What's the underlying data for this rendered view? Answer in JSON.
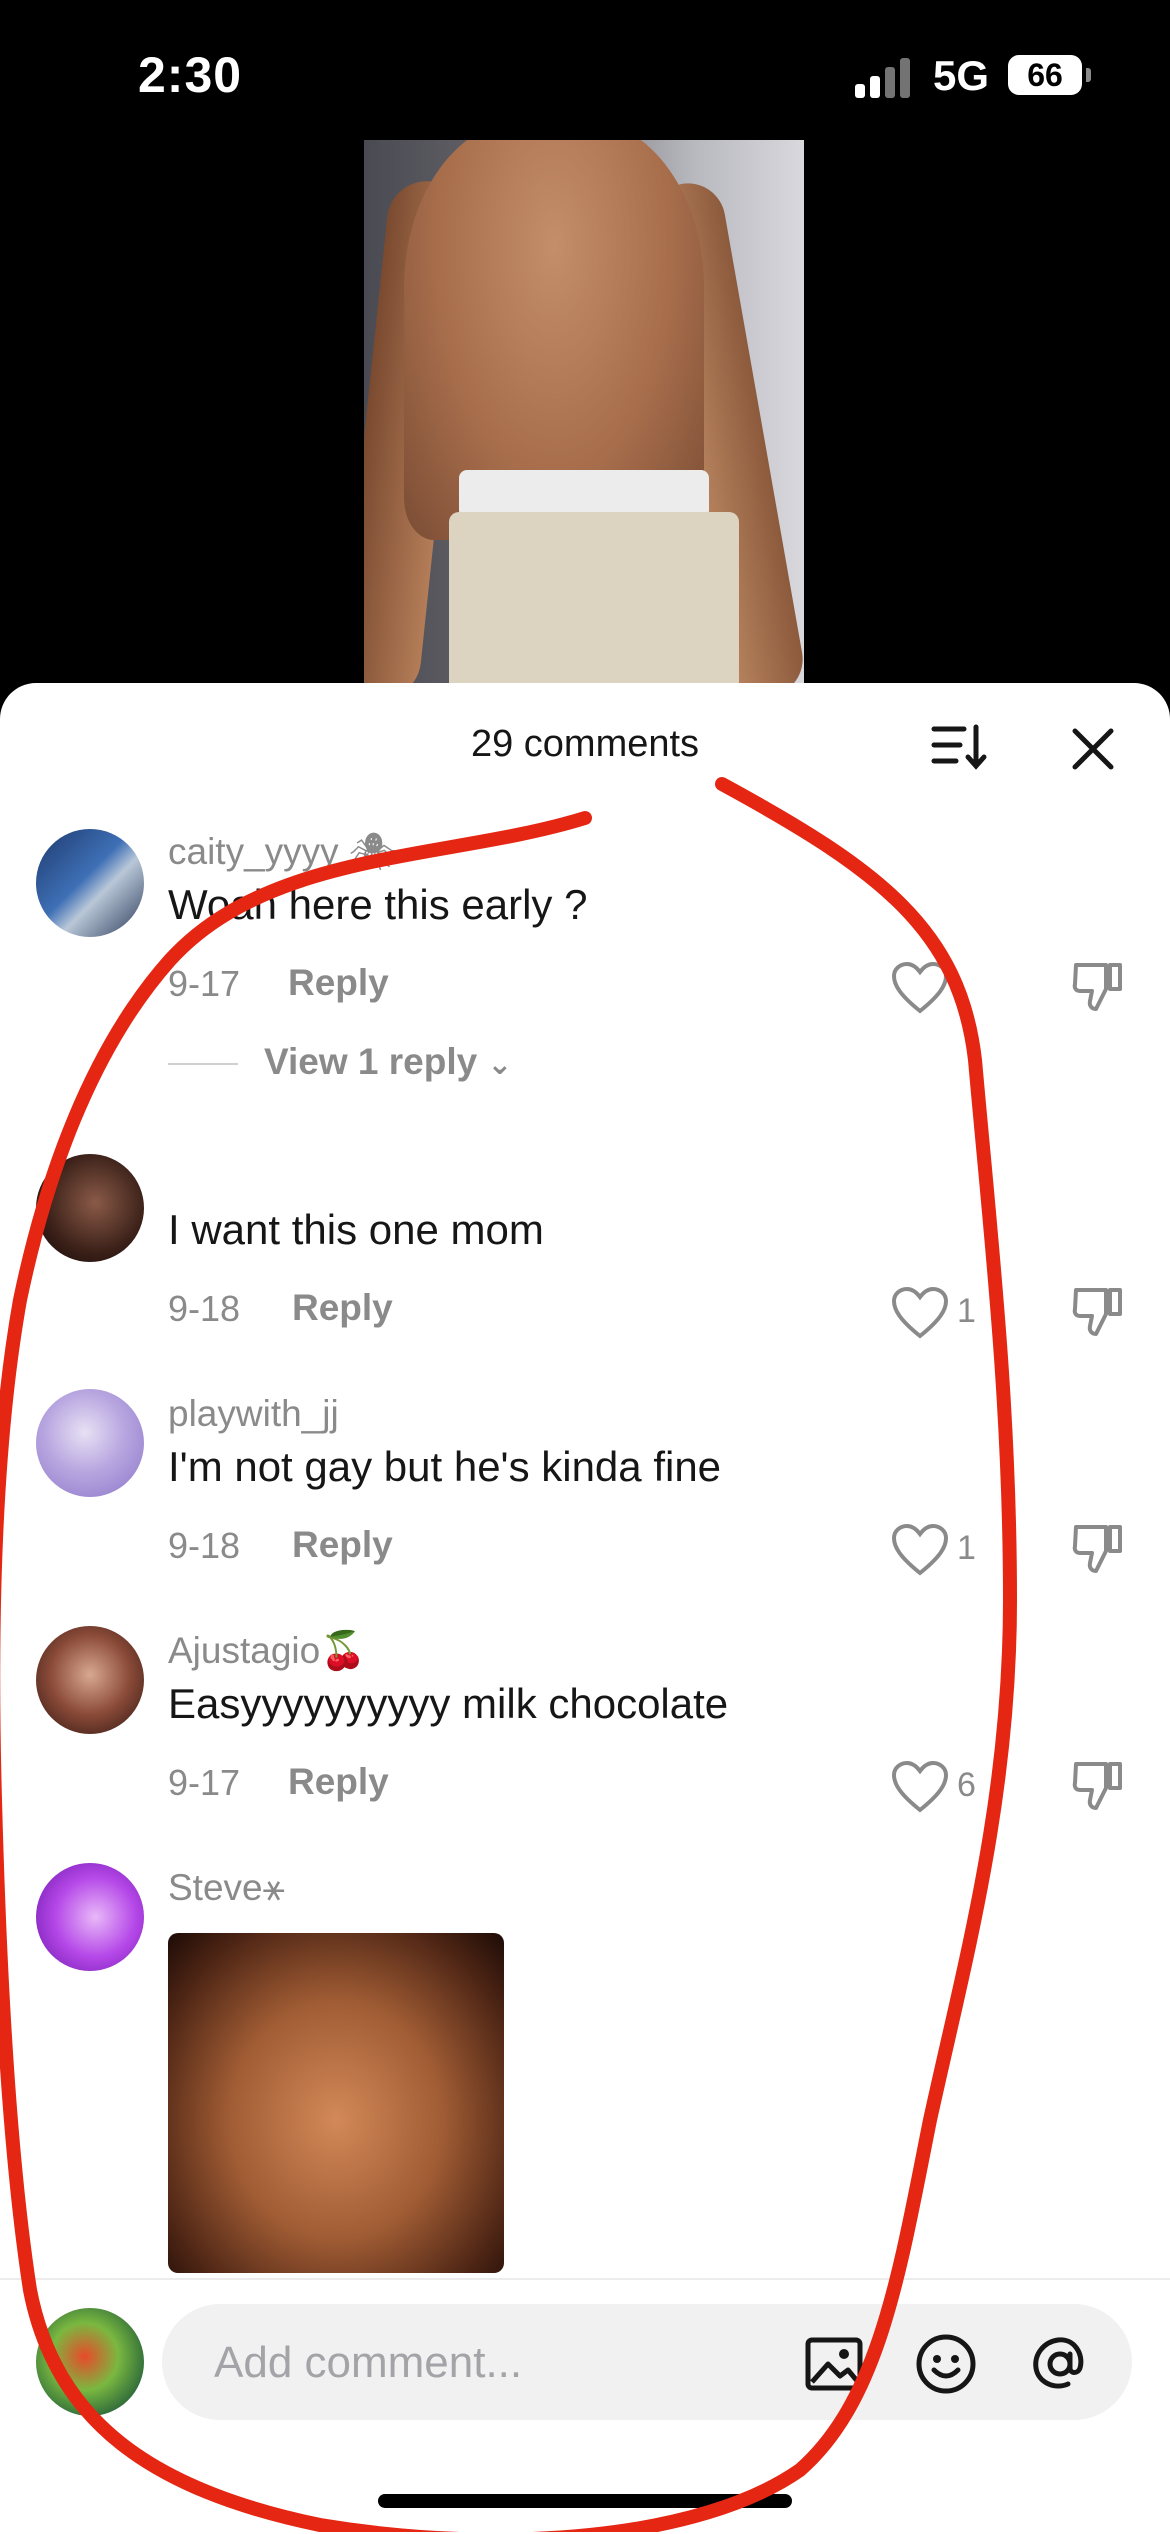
{
  "status_bar": {
    "time": "2:30",
    "network": "5G",
    "battery": "66"
  },
  "sheet": {
    "title": "29 comments"
  },
  "comments": [
    {
      "username": "caity_yyyy 🕷",
      "text": "Woah here this early ?",
      "date": "9-17",
      "reply_label": "Reply",
      "likes": "",
      "view_replies": "View 1 reply"
    },
    {
      "username": "",
      "text": "I want this one mom",
      "date": "9-18",
      "reply_label": "Reply",
      "likes": "1"
    },
    {
      "username": "playwith_jj",
      "text": "I'm not gay but he's kinda fine",
      "date": "9-18",
      "reply_label": "Reply",
      "likes": "1"
    },
    {
      "username": "Ajustagio🍒",
      "text": "Easyyyyyyyyyy milk chocolate",
      "date": "9-17",
      "reply_label": "Reply",
      "likes": "6"
    },
    {
      "username": "Steve⚹"
    }
  ],
  "input": {
    "placeholder": "Add comment..."
  },
  "icons": {
    "sort": "sort-icon",
    "close": "close-icon",
    "like": "heart-icon",
    "dislike": "thumbs-down-icon",
    "image": "image-icon",
    "emoji": "emoji-icon",
    "mention": "at-icon"
  },
  "colors": {
    "annotation": "#e52613",
    "muted": "#8a8a8a",
    "text": "#161616"
  }
}
